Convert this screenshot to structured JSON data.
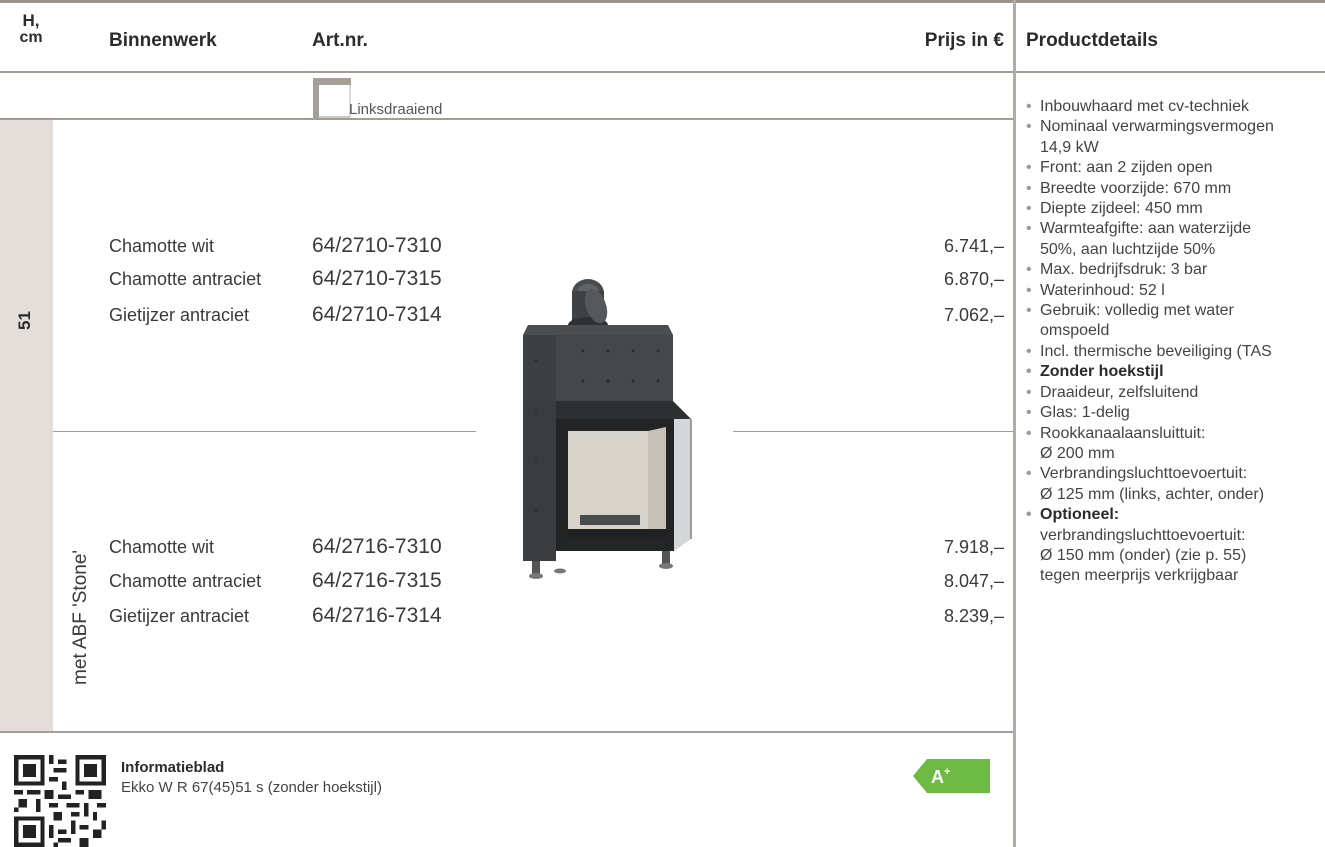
{
  "header": {
    "h_cm": "H,\ncm",
    "binnenwerk": "Binnenwerk",
    "art_nr": "Art.nr.",
    "prijs": "Prijs in €",
    "productdetails": "Productdetails"
  },
  "door": {
    "label": "Linksdraaiend"
  },
  "group": {
    "height": "51",
    "variant": "met ABF 'Stone'"
  },
  "rows_top": [
    {
      "binnenwerk": "Chamotte wit",
      "art": "64/2710-7310",
      "price": "6.741,–"
    },
    {
      "binnenwerk": "Chamotte antraciet",
      "art": "64/2710-7315",
      "price": "6.870,–"
    },
    {
      "binnenwerk": "Gietijzer antraciet",
      "art": "64/2710-7314",
      "price": "7.062,–"
    }
  ],
  "rows_bottom": [
    {
      "binnenwerk": "Chamotte wit",
      "art": "64/2716-7310",
      "price": "7.918,–"
    },
    {
      "binnenwerk": "Chamotte antraciet",
      "art": "64/2716-7315",
      "price": "8.047,–"
    },
    {
      "binnenwerk": "Gietijzer antraciet",
      "art": "64/2716-7314",
      "price": "8.239,–"
    }
  ],
  "details": [
    "Inbouwhaard met cv-techniek",
    "Nominaal verwarmingsvermogen",
    "14,9 kW",
    "Front: aan 2 zijden open",
    "Breedte voorzijde: 670 mm",
    "Diepte zijdeel: 450 mm",
    "Warmteafgifte: aan waterzijde",
    "50%, aan luchtzijde 50%",
    "Max. bedrijfsdruk: 3 bar",
    "Waterinhoud: 52 l",
    "Gebruik: volledig met water",
    "omspoeld",
    "Incl. thermische beveiliging (TAS",
    "Zonder hoekstijl",
    "Draaideur, zelfsluitend",
    "Glas: 1-delig",
    "Rookkanaalaansluittuit:",
    "Ø 200 mm",
    "Verbrandingsluchttoevoertuit:",
    "Ø 125 mm (links, achter, onder)",
    "Optioneel:",
    "verbrandingsluchttoevoertuit:",
    "Ø 150 mm (onder) (zie p. 55)",
    "tegen meerprijs verkrijgbaar"
  ],
  "info": {
    "title": "Informatieblad",
    "subtitle": "Ekko W R 67(45)51 s (zonder hoekstijl)"
  },
  "energy_label": {
    "text": "A+",
    "color": "#6dbb45"
  }
}
